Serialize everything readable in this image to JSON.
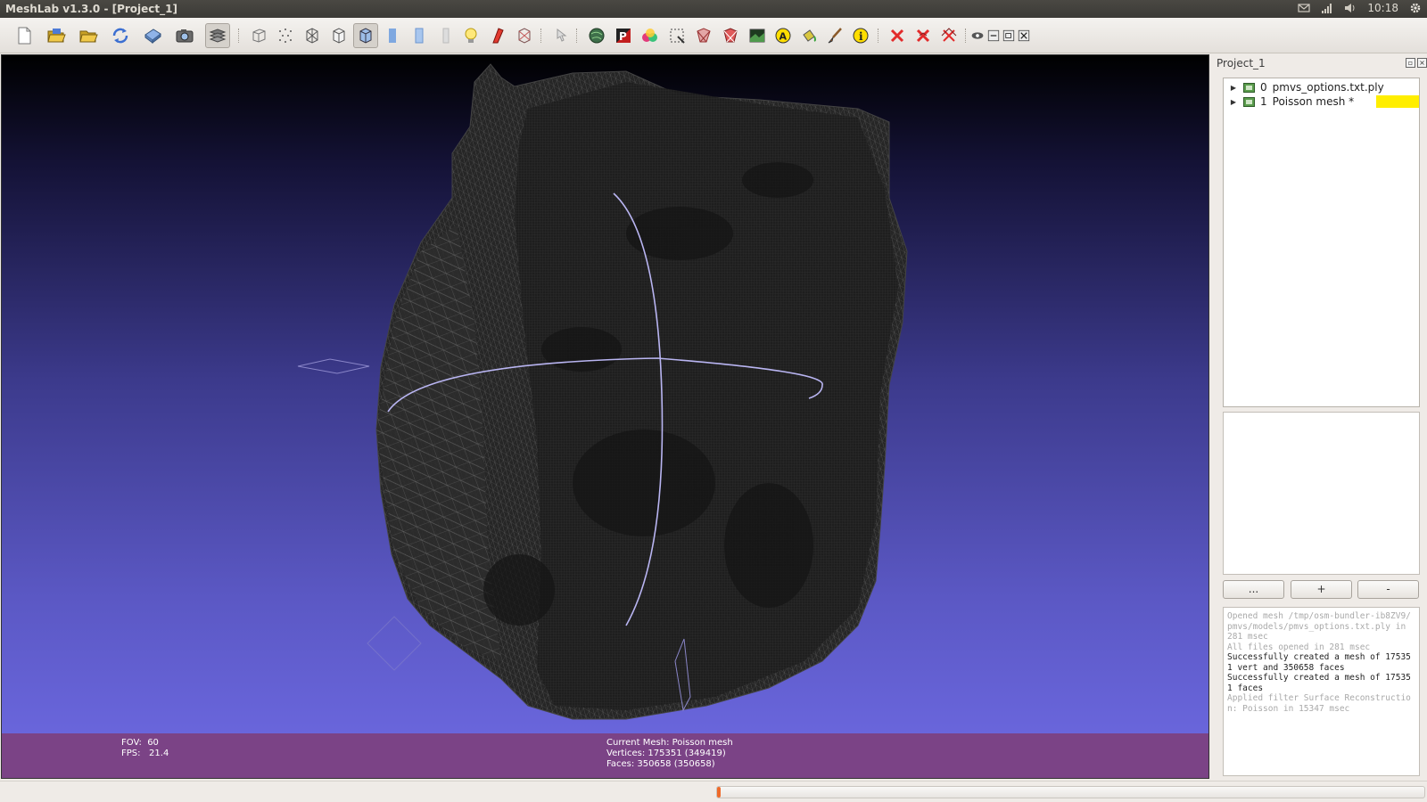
{
  "window": {
    "title": "MeshLab v1.3.0 - [Project_1]",
    "clock": "10:18",
    "tray_icons": [
      "mail-icon",
      "network-signal-icon",
      "volume-icon",
      "settings-gear-icon"
    ]
  },
  "toolbar": {
    "buttons": [
      "new-project-icon",
      "open-mesh-icon",
      "open-project-icon",
      "reload-icon",
      "save-icon",
      "snapshot-icon",
      "layers-icon",
      "bounding-box-icon",
      "points-render-icon",
      "wireframe-render-icon",
      "hidden-lines-icon",
      "flat-lines-icon",
      "flat-render-icon",
      "smooth-render-icon",
      "texture-icon",
      "light-icon",
      "double-side-lighting-icon",
      "backface-culling-icon",
      "pick-icon",
      "color-world-icon",
      "paint-p-icon",
      "color-faces-icon",
      "select-vertices-icon",
      "select-faces-icon",
      "select-connected-icon",
      "raster-icon",
      "annotate-icon",
      "paint-bucket-icon",
      "brush-icon",
      "info-icon",
      "delete-selection-icon",
      "delete-faces-icon",
      "delete-vertices-icon",
      "eye-icon",
      "window-minimize-icon",
      "window-restore-icon",
      "window-close-icon"
    ],
    "active_buttons": [
      "layers-icon",
      "flat-lines-icon"
    ]
  },
  "viewport": {
    "fov": "FOV:  60",
    "fps": "FPS:   21.4",
    "current_mesh": "Current Mesh: Poisson mesh",
    "vertices": "Vertices: 175351 (349419)",
    "faces": "Faces: 350658 (350658)",
    "colors": {
      "info_bar": "#7b4386",
      "mesh": "#2a2a2a",
      "trackball": "#b9b5f2"
    }
  },
  "panel": {
    "title": "Project_1",
    "layers": [
      {
        "index": "0",
        "name": "pmvs_options.txt.ply",
        "current": false
      },
      {
        "index": "1",
        "name": "Poisson mesh *",
        "current": true
      }
    ],
    "current_color": "#ffee00",
    "buttons": {
      "more": "...",
      "add": "+",
      "remove": "-"
    }
  },
  "log": [
    {
      "text": "Opened mesh /tmp/osm-bundler-ib8ZV9/pmvs/models/pmvs_options.txt.ply in 281 msec",
      "dim": true
    },
    {
      "text": "All files opened in 281 msec",
      "dim": true
    },
    {
      "text": "Successfully created a mesh of 175351 vert and 350658 faces",
      "dim": false
    },
    {
      "text": "Successfully created a mesh of 175351 faces",
      "dim": false
    },
    {
      "text": "Applied filter Surface Reconstruction: Poisson in 15347 msec",
      "dim": true
    }
  ],
  "status": {
    "progress": 0.005
  }
}
